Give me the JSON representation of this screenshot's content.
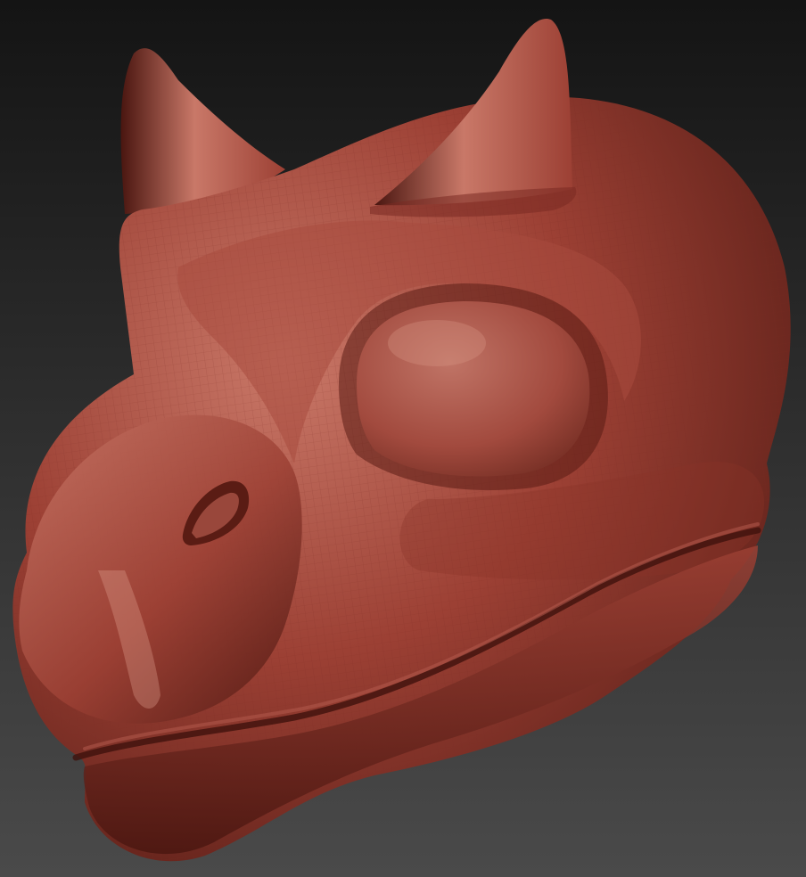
{
  "viewport": {
    "background_top": "#141414",
    "background_bottom": "#4a4a4a"
  },
  "model": {
    "kind": "sculpted-creature-head",
    "material_color": "#9c4034",
    "highlight_color": "#c97868",
    "shadow_color": "#4a1610",
    "wire_color": "#7a2a22"
  }
}
